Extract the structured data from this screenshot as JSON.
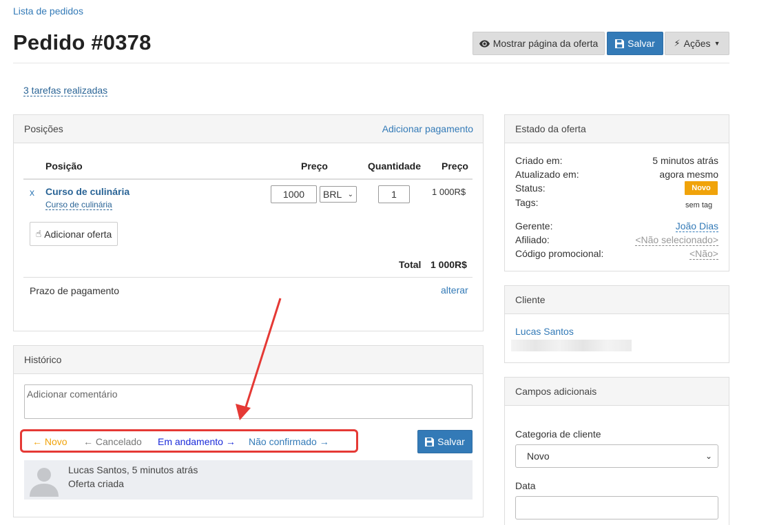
{
  "breadcrumb": "Lista de pedidos",
  "page_title": "Pedido #0378",
  "toolbar": {
    "show_offer_label": "Mostrar página da oferta",
    "save_label": "Salvar",
    "actions_label": "Ações"
  },
  "tasks_link": "3 tarefas realizadas",
  "positions": {
    "title": "Posições",
    "add_payment": "Adicionar pagamento",
    "columns": [
      "Posição",
      "Preço",
      "Quantidade",
      "Preço"
    ],
    "item": {
      "remove": "x",
      "name": "Curso de culinária",
      "sublink": "Curso de culinária",
      "price": "1000",
      "currency": "BRL",
      "quantity": "1",
      "total": "1 000R$"
    },
    "add_offer": "Adicionar oferta",
    "total_label": "Total",
    "total_value": "1 000R$",
    "payment_term_label": "Prazo de pagamento",
    "change_link": "alterar"
  },
  "history": {
    "title": "Histórico",
    "comment_placeholder": "Adicionar comentário",
    "statuses": {
      "novo": "Novo",
      "cancelado": "Cancelado",
      "andamento": "Em andamento",
      "nao_confirmado": "Não confirmado"
    },
    "save_label": "Salvar",
    "entry": {
      "author_time": "Lucas Santos, 5 minutos atrás",
      "text": "Oferta criada"
    }
  },
  "offer_state": {
    "title": "Estado da oferta",
    "created_label": "Criado em:",
    "created_value": "5 minutos atrás",
    "updated_label": "Atualizado em:",
    "updated_value": "agora mesmo",
    "status_label": "Status:",
    "status_value": "Novo",
    "tags_label": "Tags:",
    "tags_value": "sem tag",
    "manager_label": "Gerente:",
    "manager_value": "João Dias",
    "affiliate_label": "Afiliado:",
    "affiliate_value": "<Não selecionado>",
    "promo_label": "Código promocional:",
    "promo_value": "<Não>"
  },
  "client": {
    "title": "Cliente",
    "name": "Lucas Santos"
  },
  "extra_fields": {
    "title": "Campos adicionais",
    "category_label": "Categoria de cliente",
    "category_value": "Novo",
    "date_label": "Data"
  },
  "colors": {
    "primary": "#337ab7",
    "status_new": "#f0a30a",
    "highlight": "#e53935"
  }
}
